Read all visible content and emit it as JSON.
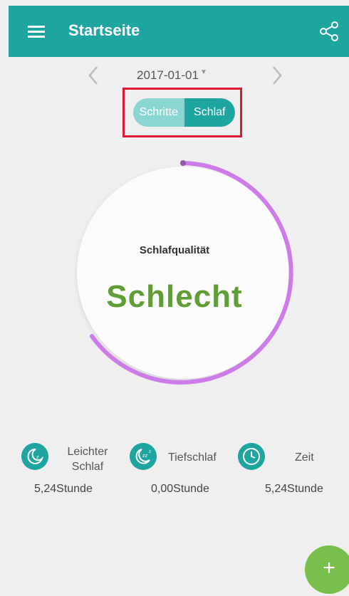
{
  "header": {
    "title": "Startseite"
  },
  "date": {
    "value": "2017-01-01"
  },
  "toggle": {
    "steps": "Schritte",
    "sleep": "Schlaf"
  },
  "gauge": {
    "label": "Schlafqualität",
    "value": "Schlecht"
  },
  "stats": [
    {
      "icon": "moon-icon",
      "label": "Leichter Schlaf",
      "value": "5,24Stunde"
    },
    {
      "icon": "moon-zzz-icon",
      "label": "Tiefschlaf",
      "value": "0,00Stunde"
    },
    {
      "icon": "clock-icon",
      "label": "Zeit",
      "value": "5,24Stunde"
    }
  ],
  "fab": {
    "label": "+"
  },
  "colors": {
    "primary": "#1fa5a0",
    "accent": "#78c04b",
    "arc": "#cc7be8",
    "quality": "#5f9d35",
    "highlight": "#e1182f"
  }
}
